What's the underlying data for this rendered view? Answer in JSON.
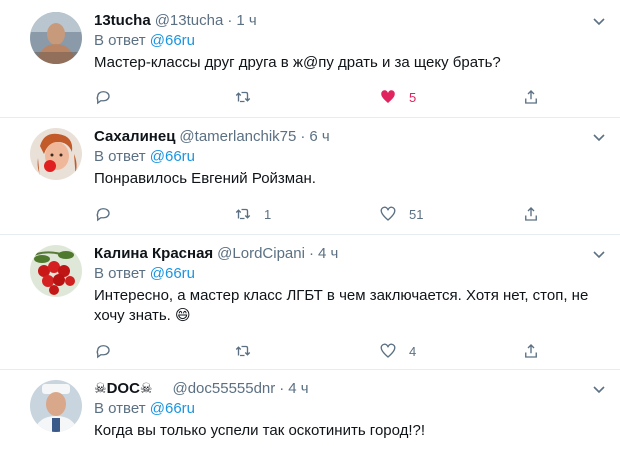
{
  "reply_prefix": "В ответ",
  "tweets": [
    {
      "name": "13tucha",
      "handle": "@13tucha",
      "separator": "·",
      "time": "1 ч",
      "reply_to": "@66ru",
      "text": "Мастер-классы друг друга в ж@пу драть и за щеку брать?",
      "replies": "",
      "retweets": "",
      "likes": "5",
      "liked": true
    },
    {
      "name": "Сахалинец",
      "handle": "@tamerlanchik75",
      "separator": "·",
      "time": "6 ч",
      "reply_to": "@66ru",
      "text": "Понравилось Евгений Ройзман.",
      "replies": "",
      "retweets": "1",
      "likes": "51",
      "liked": false
    },
    {
      "name": "Калина Красная",
      "handle": "@LordCipani",
      "separator": "·",
      "time": "4 ч",
      "reply_to": "@66ru",
      "text": "Интересно, а мастер класс ЛГБТ в чем заключается. Хотя нет, стоп, не хочу знать.",
      "emoji": "😄",
      "replies": "",
      "retweets": "",
      "likes": "4",
      "liked": false
    },
    {
      "name_prefix": "☠",
      "name": "DOC",
      "name_suffix": "☠",
      "handle": "@doc55555dnr",
      "separator": "·",
      "time": "4 ч",
      "reply_to": "@66ru",
      "text": "Когда вы только успели так оскотинить город!?!"
    }
  ],
  "colors": {
    "accent": "#1b95e0",
    "secondary_text": "#5b7083",
    "like_active": "#e0245e",
    "divider": "#e6ecf0"
  },
  "icons": [
    "reply-icon",
    "retweet-icon",
    "like-icon",
    "share-icon",
    "more-icon"
  ]
}
